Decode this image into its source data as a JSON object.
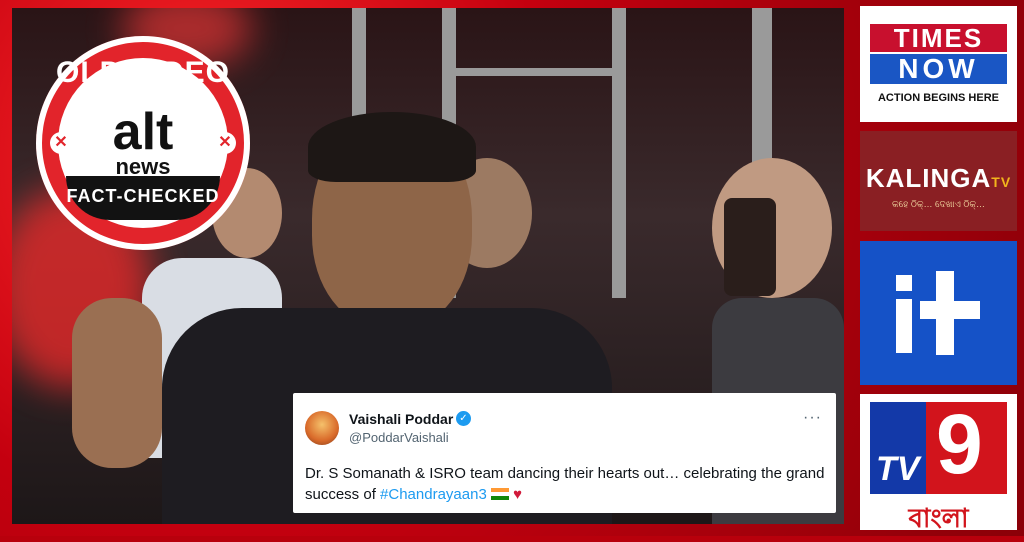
{
  "badge": {
    "top_text": "OLD VIDEO",
    "logo_top": "alt",
    "logo_bottom": "news",
    "bottom_text": "FACT-CHECKED",
    "accent_color": "#e2242b"
  },
  "tweet": {
    "name": "Vaishali Poddar",
    "handle": "@PoddarVaishali",
    "text_main": "Dr. S Somanath & ISRO team dancing their hearts out… celebrating the grand success of ",
    "hashtag": "#Chandrayaan3",
    "more_icon": "ellipsis-icon",
    "verified_icon": "verified-badge-icon",
    "emoji": [
      "india-flag-icon",
      "red-heart-icon"
    ]
  },
  "logos": {
    "times_now": {
      "line1": "TIMES",
      "line2": "NOW",
      "tagline": "ACTION BEGINS HERE"
    },
    "kalinga": {
      "name": "KALINGA",
      "suffix": "TV",
      "tagline": "କହେ ଠିକ୍… ଦେଖାଏ ଠିକ୍…"
    },
    "india_today": {
      "icon": "it-logo-icon"
    },
    "tv9": {
      "tv": "TV",
      "num": "9",
      "lang": "বাংলা"
    }
  }
}
